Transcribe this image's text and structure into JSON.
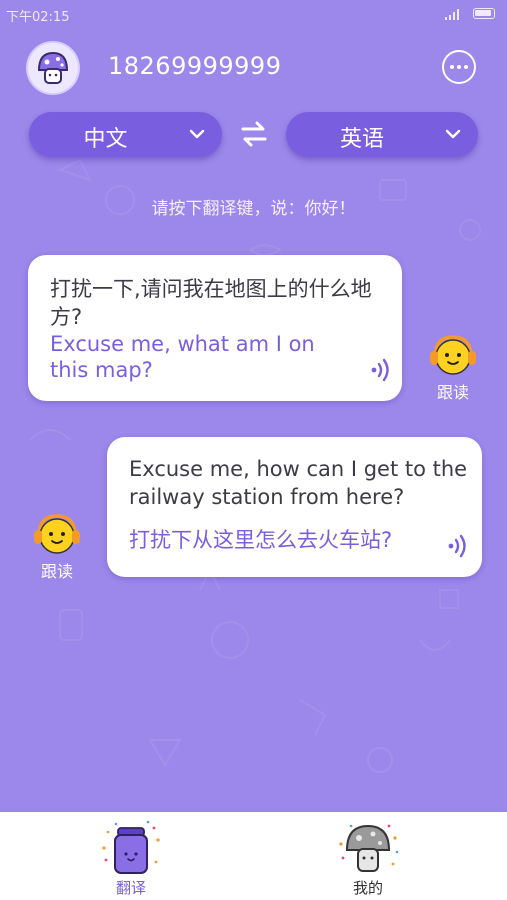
{
  "status_bar": {
    "time": "下午02:15"
  },
  "header": {
    "phone_number": "18269999999",
    "avatar_icon": "mushroom-avatar-icon",
    "more_icon": "more-dots-icon"
  },
  "language_bar": {
    "source_language": "中文",
    "target_language": "英语",
    "swap_icon": "swap-arrows-icon"
  },
  "hint": "请按下翻译键，说：你好！",
  "conversation": [
    {
      "source_text": "打扰一下,请问我在地图上的什么地方?",
      "translation": "Excuse me, what am I on this map?"
    },
    {
      "source_text": "Excuse me, how can I get to the railway station from here?",
      "translation": "打扰下从这里怎么去火车站?"
    }
  ],
  "follow_read_label": "跟读",
  "bottom_nav": {
    "items": [
      {
        "label": "翻译",
        "icon": "translate-jar-icon"
      },
      {
        "label": "我的",
        "icon": "mushroom-profile-icon"
      }
    ]
  },
  "colors": {
    "background": "#9b88ea",
    "accent": "#7a5ee0",
    "bubble": "#ffffff"
  }
}
